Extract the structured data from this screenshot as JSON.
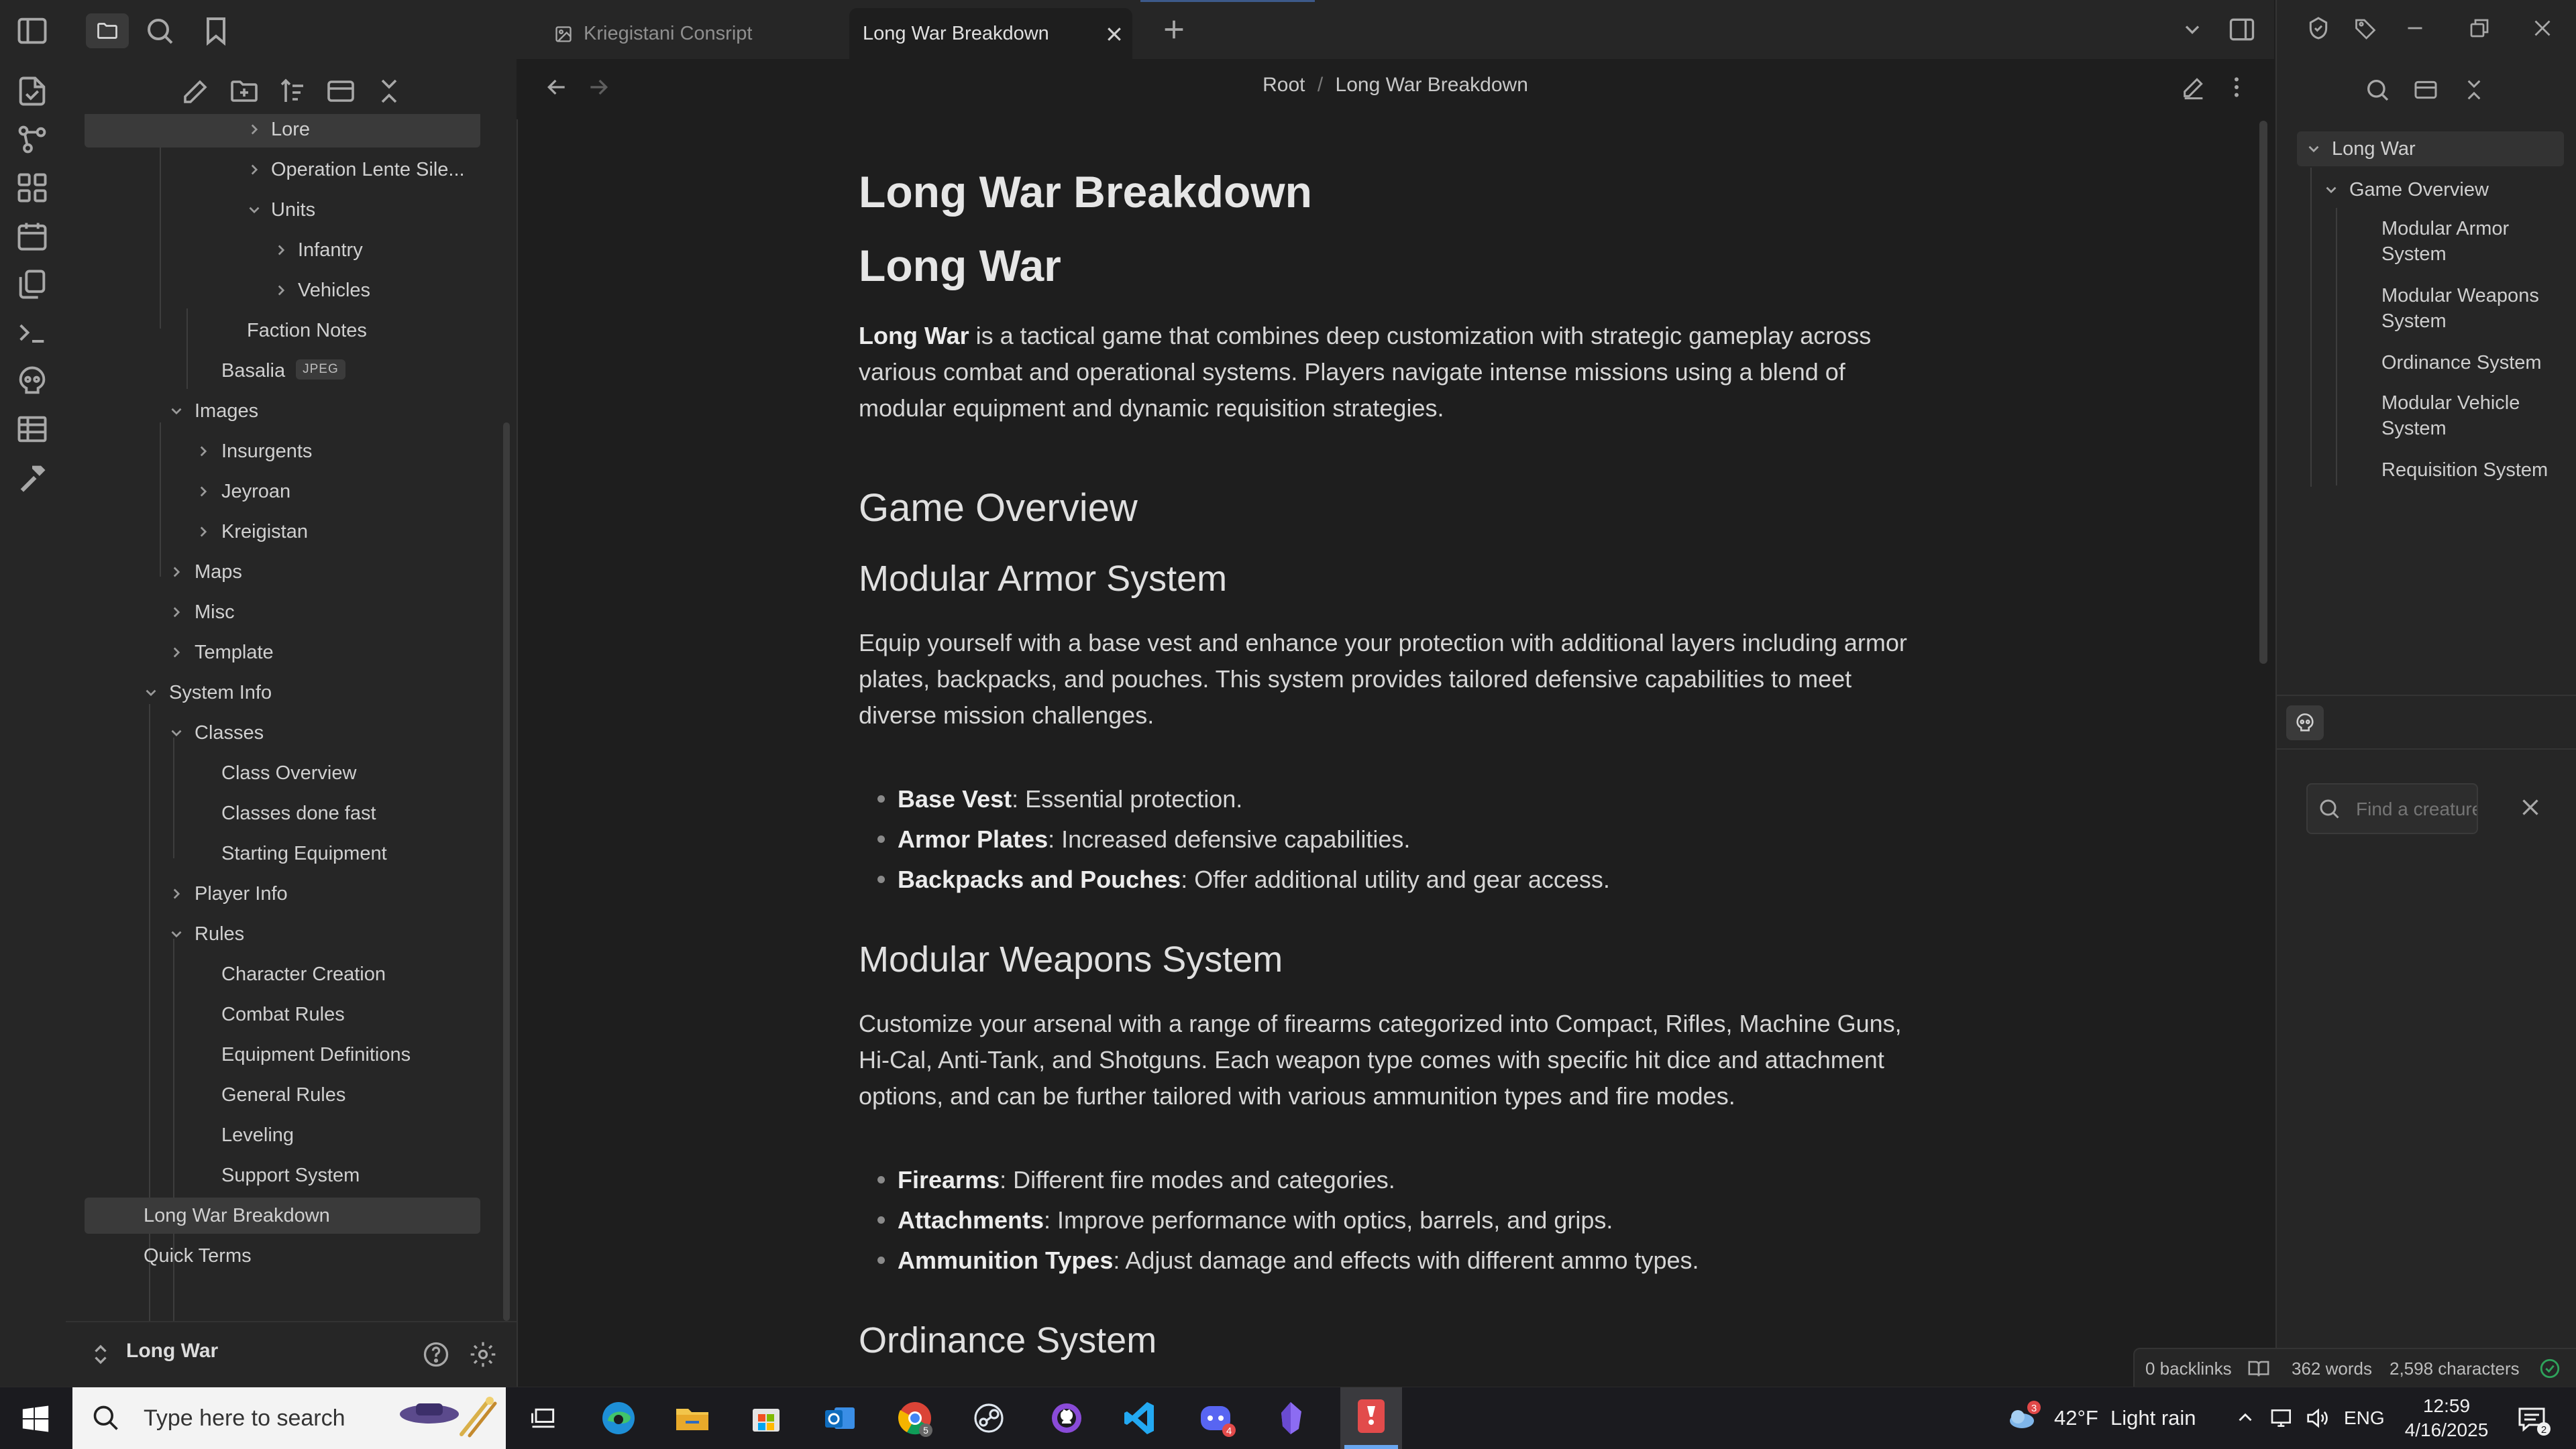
{
  "tabs": [
    {
      "label": "Kriegistani Consript",
      "active": false
    },
    {
      "label": "Long War Breakdown",
      "active": true
    }
  ],
  "breadcrumb": {
    "root": "Root",
    "separator": "/",
    "current": "Long War Breakdown"
  },
  "explorer": {
    "items": {
      "lore": "Lore",
      "operation": "Operation Lente Sile...",
      "units": "Units",
      "infantry": "Infantry",
      "vehicles": "Vehicles",
      "faction_notes": "Faction Notes",
      "basalia": "Basalia",
      "basalia_badge": "JPEG",
      "images": "Images",
      "insurgents": "Insurgents",
      "jeyroan": "Jeyroan",
      "kreigistan": "Kreigistan",
      "maps": "Maps",
      "misc": "Misc",
      "template": "Template",
      "system_info": "System Info",
      "classes": "Classes",
      "class_overview": "Class Overview",
      "classes_done_fast": "Classes done fast",
      "starting_equipment": "Starting Equipment",
      "player_info": "Player Info",
      "rules": "Rules",
      "character_creation": "Character Creation",
      "combat_rules": "Combat Rules",
      "equipment_definitions": "Equipment Definitions",
      "general_rules": "General Rules",
      "leveling": "Leveling",
      "support_system": "Support System",
      "long_war_breakdown": "Long War Breakdown",
      "quick_terms": "Quick Terms"
    },
    "vault_name": "Long War"
  },
  "document": {
    "title": "Long War Breakdown",
    "h1": "Long War",
    "intro_bold": "Long War",
    "intro_rest": " is a tactical game that combines deep customization with strategic gameplay across various combat and operational systems. Players navigate intense missions using a blend of modular equipment and dynamic requisition strategies.",
    "game_overview": "Game Overview",
    "armor": {
      "heading": "Modular Armor System",
      "text": "Equip yourself with a base vest and enhance your protection with additional layers including armor plates, backpacks, and pouches. This system provides tailored defensive capabilities to meet diverse mission challenges.",
      "bullets": [
        {
          "bold": "Base Vest",
          "rest": ": Essential protection."
        },
        {
          "bold": "Armor Plates",
          "rest": ": Increased defensive capabilities."
        },
        {
          "bold": "Backpacks and Pouches",
          "rest": ": Offer additional utility and gear access."
        }
      ]
    },
    "weapons": {
      "heading": "Modular Weapons System",
      "text": "Customize your arsenal with a range of firearms categorized into Compact, Rifles, Machine Guns, Hi-Cal, Anti-Tank, and Shotguns. Each weapon type comes with specific hit dice and attachment options, and can be further tailored with various ammunition types and fire modes.",
      "bullets": [
        {
          "bold": "Firearms",
          "rest": ": Different fire modes and categories."
        },
        {
          "bold": "Attachments",
          "rest": ": Improve performance with optics, barrels, and grips."
        },
        {
          "bold": "Ammunition Types",
          "rest": ": Adjust damage and effects with different ammo types."
        }
      ]
    },
    "ordinance": "Ordinance System"
  },
  "outline": {
    "items": [
      "Long War",
      "Game Overview",
      "Modular Armor System",
      "Modular Weapons System",
      "Ordinance System",
      "Modular Vehicle System",
      "Requisition System"
    ],
    "armor_lines": [
      "Modular Armor",
      "System"
    ],
    "weapons_lines": [
      "Modular Weapons",
      "System"
    ],
    "vehicle_lines": [
      "Modular Vehicle",
      "System"
    ]
  },
  "creature_search": {
    "placeholder": "Find a creature"
  },
  "status": {
    "backlinks": "0 backlinks",
    "words": "362 words",
    "characters": "2,598 characters"
  },
  "taskbar": {
    "search_placeholder": "Type here to search",
    "weather_temp": "42°F",
    "weather_text": "Light rain",
    "weather_badge": "3",
    "lang": "ENG",
    "time": "12:59",
    "date": "4/16/2025",
    "notifications": "2",
    "discord_badge": "4",
    "chrome_badge": "5"
  },
  "colors": {
    "background": "#1e1e1e",
    "sidebar": "#262626",
    "selected": "#3a3a3a",
    "accent_green": "#2fa35b"
  }
}
